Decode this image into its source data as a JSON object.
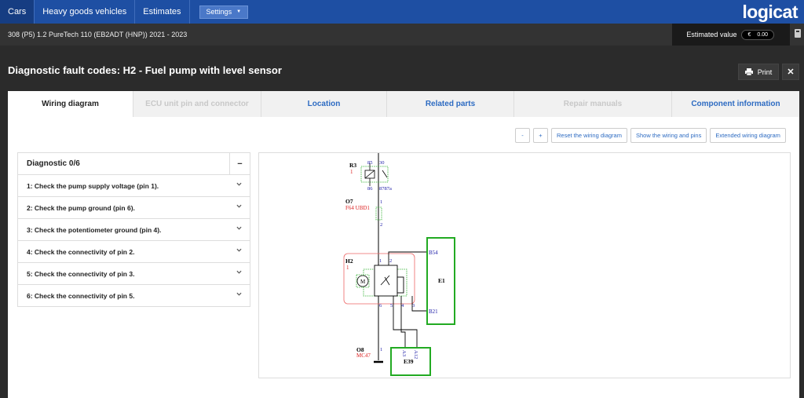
{
  "nav": {
    "items": [
      {
        "label": "Cars"
      },
      {
        "label": "Heavy goods vehicles"
      },
      {
        "label": "Estimates"
      }
    ],
    "settings_label": "Settings",
    "logo_text": "logicat"
  },
  "vehicle": {
    "description": "308 (P5) 1.2 PureTech 110 (EB2ADT (HNP)) 2021 - 2023",
    "estimated_label": "Estimated value",
    "currency": "€",
    "estimated_value": "0.00"
  },
  "page": {
    "title": "Diagnostic fault codes: H2 - Fuel pump with level sensor",
    "print_label": "Print",
    "close_label": "✕"
  },
  "tabs": [
    {
      "label": "Wiring diagram",
      "state": "active"
    },
    {
      "label": "ECU unit pin and connector",
      "state": "disabled"
    },
    {
      "label": "Location",
      "state": "enabled"
    },
    {
      "label": "Related parts",
      "state": "enabled"
    },
    {
      "label": "Repair manuals",
      "state": "disabled"
    },
    {
      "label": "Component information",
      "state": "enabled"
    }
  ],
  "toolbar": {
    "zoom_out": "-",
    "zoom_in": "+",
    "reset": "Reset the wiring diagram",
    "show": "Show the wiring and pins",
    "extended": "Extended wiring diagram"
  },
  "diagnostic": {
    "title": "Diagnostic 0/6",
    "collapse": "−",
    "steps": [
      "1: Check the pump supply voltage (pin 1).",
      "2: Check the pump ground (pin 6).",
      "3: Check the potentiometer ground (pin 4).",
      "4: Check the connectivity of pin 2.",
      "5: Check the connectivity of pin 3.",
      "6: Check the connectivity of pin 5."
    ]
  },
  "diagram": {
    "r3_name": "R3",
    "r3_num": "1",
    "r3_pin_85": "85",
    "r3_pin_30": "30",
    "r3_pin_86": "86",
    "r3_pin_87": "8787a",
    "o7_name": "O7",
    "o7_sub": "F64 UBD1",
    "o7_pin1": "1",
    "o7_pin2": "2",
    "h2_name": "H2",
    "h2_num": "1",
    "h2_pin1": "1",
    "h2_pin2": "2",
    "h2_pin6": "6",
    "h2_pin5": "5",
    "h2_pin4": "4",
    "h2_pin3": "3",
    "motor": "M",
    "e1_name": "E1",
    "e1_b54": "B54",
    "e1_b21": "B21",
    "o8_name": "O8",
    "o8_sub": "MC47",
    "o8_pin": "1",
    "e39_name": "E39",
    "e39_a3": "A3",
    "e39_a12": "A12"
  }
}
